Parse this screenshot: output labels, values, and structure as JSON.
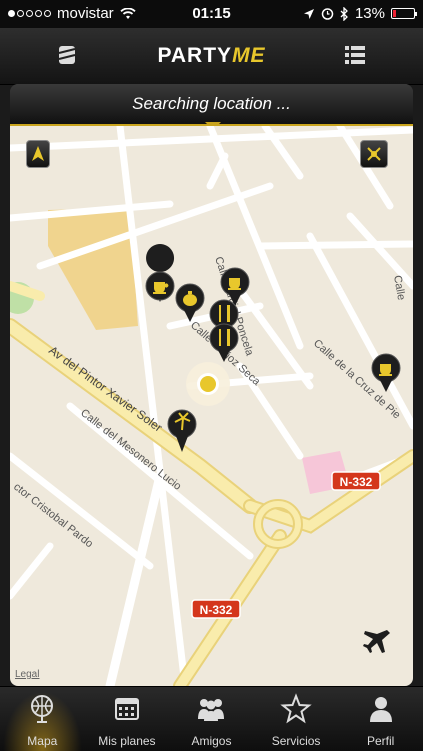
{
  "status": {
    "carrier": "movistar",
    "time": "01:15",
    "battery": "13%",
    "battery_fraction": 0.13
  },
  "header": {
    "logo_main": "PARTY",
    "logo_accent": "ME"
  },
  "banner": {
    "text": "Searching location ..."
  },
  "map": {
    "streets": [
      "Calle Jardiel Poncela",
      "Calle de la Cruz de Pie",
      "Av del Pintor Xavier Soler",
      "Calle del Mesonero Lucio",
      "ctor Cristobal Pardo",
      "Calle",
      "Calle Muñoz Seca"
    ],
    "road_badges": [
      "N-332",
      "N-332"
    ],
    "legal": "Legal",
    "pins": [
      "coffee-cup-pin",
      "teapot-pin",
      "coffee-cup-pin",
      "cutlery-pin",
      "cutlery-pin",
      "coffee-cup-pin",
      "palm-tree-pin"
    ]
  },
  "tabs": [
    {
      "label": "Mapa",
      "icon": "globe-icon",
      "active": true
    },
    {
      "label": "Mis planes",
      "icon": "calendar-icon",
      "active": false
    },
    {
      "label": "Amigos",
      "icon": "friends-icon",
      "active": false
    },
    {
      "label": "Servicios",
      "icon": "star-icon",
      "active": false
    },
    {
      "label": "Perfil",
      "icon": "profile-icon",
      "active": false
    }
  ],
  "colors": {
    "accent": "#e8c72c",
    "map_bg": "#efe9dc",
    "road_major": "#f6e79a",
    "road_badge": "#d4361c",
    "pin": "#1e1e1e"
  }
}
